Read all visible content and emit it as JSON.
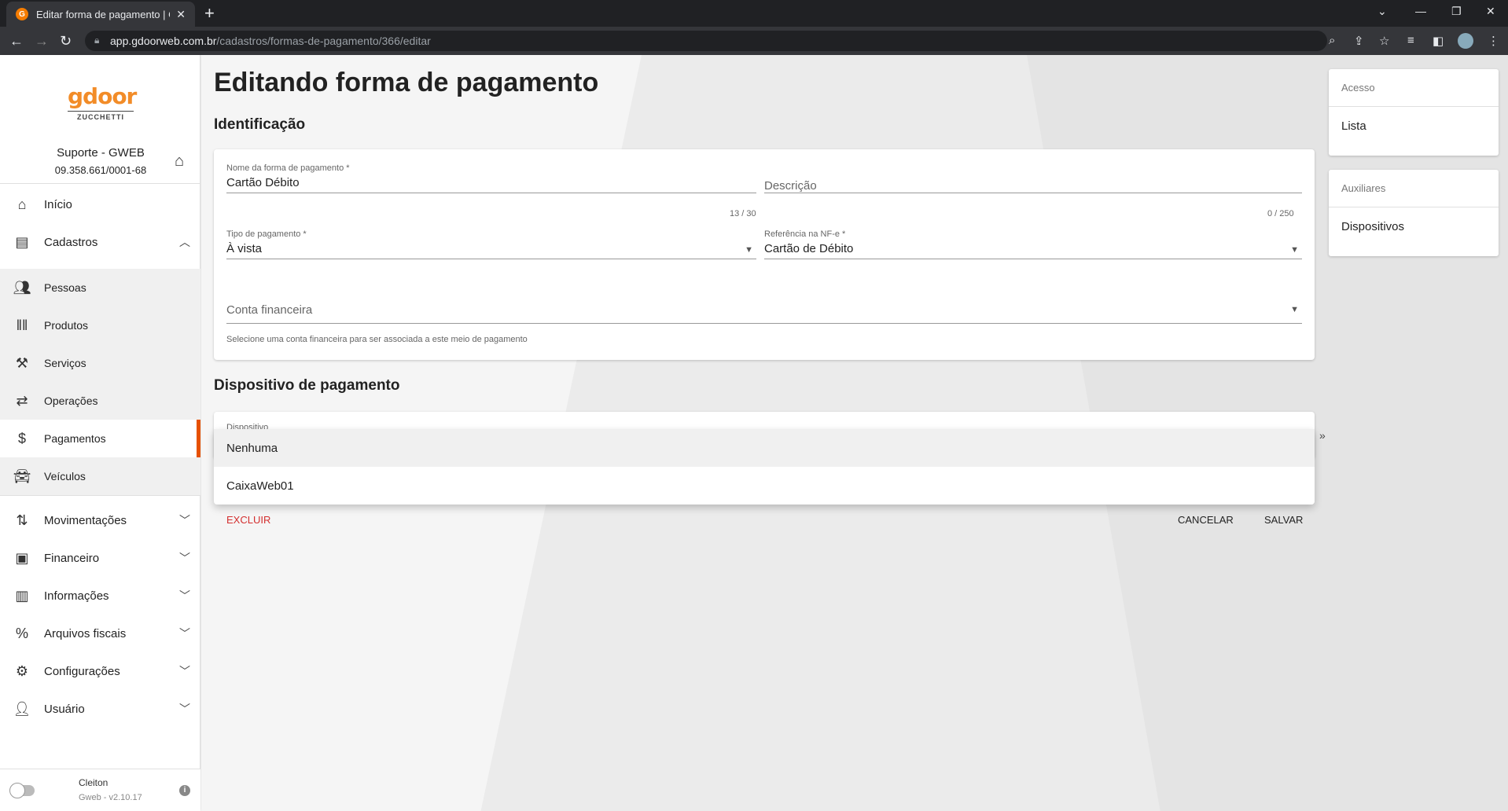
{
  "browser": {
    "tab_title": "Editar forma de pagamento | Gw",
    "tab_favicon": "G",
    "url_host": "app.gdoorweb.com.br",
    "url_path": "/cadastros/formas-de-pagamento/366/editar"
  },
  "sidebar": {
    "logo": "gdoor",
    "logo_sub": "ZUCCHETTI",
    "company_name": "Suporte - GWEB",
    "company_cnpj": "09.358.661/0001-68",
    "items": [
      {
        "label": "Início",
        "icon": "home-icon"
      },
      {
        "label": "Cadastros",
        "icon": "list-icon"
      },
      {
        "label": "Pessoas",
        "icon": "people-icon"
      },
      {
        "label": "Produtos",
        "icon": "barcode-icon"
      },
      {
        "label": "Serviços",
        "icon": "hammer-icon"
      },
      {
        "label": "Operações",
        "icon": "swap-icon"
      },
      {
        "label": "Pagamentos",
        "icon": "dollar-icon"
      },
      {
        "label": "Veículos",
        "icon": "car-icon"
      },
      {
        "label": "Movimentações",
        "icon": "sort-icon"
      },
      {
        "label": "Financeiro",
        "icon": "cash-icon"
      },
      {
        "label": "Informações",
        "icon": "chart-icon"
      },
      {
        "label": "Arquivos fiscais",
        "icon": "percent-icon"
      },
      {
        "label": "Configurações",
        "icon": "settings-icon"
      },
      {
        "label": "Usuário",
        "icon": "user-icon"
      }
    ],
    "user_name": "Cleiton",
    "app_version": "Gweb - v2.10.17",
    "accent_color": "#e65100"
  },
  "main": {
    "page_title": "Editando forma de pagamento",
    "section_identification": "Identificação",
    "fields": {
      "name_label": "Nome da forma de pagamento *",
      "name_value": "Cartão Débito",
      "name_counter": "13 / 30",
      "description_placeholder": "Descrição",
      "description_counter": "0 / 250",
      "payment_type_label": "Tipo de pagamento *",
      "payment_type_value": "À vista",
      "nfe_reference_label": "Referência na NF-e *",
      "nfe_reference_value": "Cartão de Débito",
      "financial_account_placeholder": "Conta financeira",
      "financial_account_hint": "Selecione uma conta financeira para ser associada a este meio de pagamento"
    },
    "section_device": "Dispositivo de pagamento",
    "device_label": "Dispositivo",
    "device_menu_options": [
      "Nenhuma",
      "CaixaWeb01"
    ],
    "buttons": {
      "delete": "EXCLUIR",
      "cancel": "CANCELAR",
      "save": "SALVAR"
    }
  },
  "right_panel": {
    "access_header": "Acesso",
    "access_item": "Lista",
    "aux_header": "Auxiliares",
    "aux_item": "Dispositivos",
    "collapse_glyph": "»"
  }
}
